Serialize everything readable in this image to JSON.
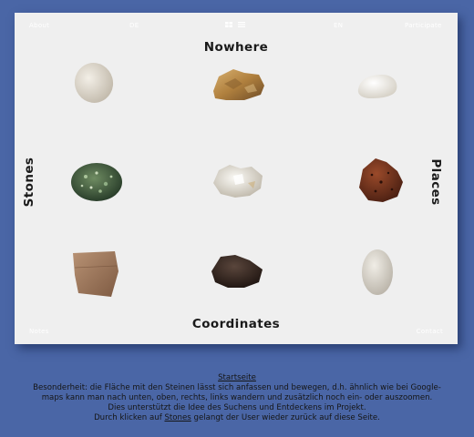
{
  "nav": {
    "about": "About",
    "de": "DE",
    "en": "EN",
    "participate": "Participate",
    "notes": "Notes",
    "contact": "Contact"
  },
  "titles": {
    "top": "Nowhere",
    "left": "Stones",
    "right": "Places",
    "bottom": "Coordinates"
  },
  "icons": [
    "grid-view-icon",
    "list-view-icon"
  ],
  "stones": [
    {
      "name": "stone-cream-pebble",
      "color": "#d8d2c8"
    },
    {
      "name": "stone-ochre-rough",
      "color": "#b48a4c"
    },
    {
      "name": "stone-white-small",
      "color": "#f2efe8"
    },
    {
      "name": "stone-green-speckled",
      "color": "#3d5a3c"
    },
    {
      "name": "stone-white-quartz",
      "color": "#e4e0d8"
    },
    {
      "name": "stone-red-lava",
      "color": "#7a3a22"
    },
    {
      "name": "stone-brown-flat",
      "color": "#a98467"
    },
    {
      "name": "stone-dark-coal",
      "color": "#3a2a24"
    },
    {
      "name": "stone-grey-oval",
      "color": "#d9d5cc"
    }
  ],
  "caption": {
    "heading": "Startseite",
    "line1": "Besonderheit: die Fläche mit den Steinen lässt sich anfassen und bewegen, d.h. ähnlich wie bei Google-",
    "line2": "maps kann man nach unten, oben, rechts, links wandern und zusätzlich noch ein- oder auszoomen.",
    "line3": "Dies unterstützt die Idee des Suchens und Entdeckens im Projekt.",
    "line4_pre": "Durch klicken auf ",
    "line4_link": "Stones",
    "line4_post": " gelangt der User wieder zurück auf diese Seite."
  },
  "colors": {
    "background": "#4a66a6",
    "card": "#efefef",
    "text": "#1a1a1a"
  }
}
